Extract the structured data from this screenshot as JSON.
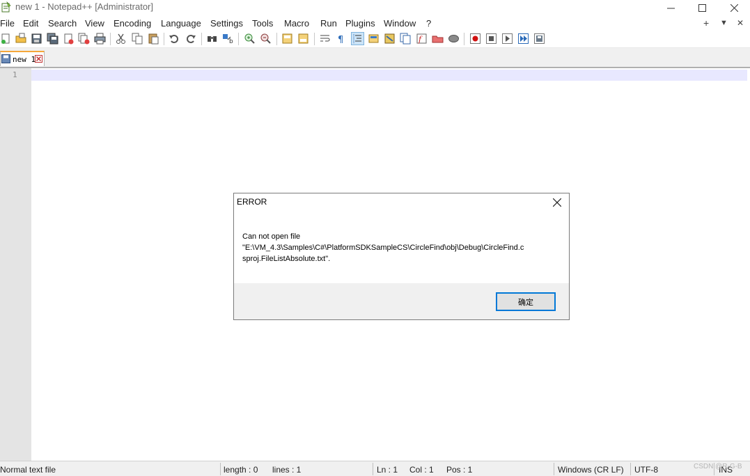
{
  "window": {
    "title": "new 1 - Notepad++ [Administrator]",
    "controls": {
      "minimize": "—",
      "maximize": "☐",
      "close": "✕"
    }
  },
  "menu": {
    "items": [
      "File",
      "Edit",
      "Search",
      "View",
      "Encoding",
      "Language",
      "Settings",
      "Tools",
      "Macro",
      "Run",
      "Plugins",
      "Window",
      "?"
    ],
    "right": {
      "add": "+",
      "dropdown": "▼",
      "close": "✕"
    }
  },
  "toolbar": {
    "icons": [
      "new-file-icon",
      "open-file-icon",
      "save-icon",
      "save-all-icon",
      "close-icon",
      "close-all-icon",
      "print-icon",
      "cut-icon",
      "copy-icon",
      "paste-icon",
      "undo-icon",
      "redo-icon",
      "find-icon",
      "replace-icon",
      "zoom-in-icon",
      "zoom-out-icon",
      "sync-vertical-icon",
      "sync-horizontal-icon",
      "word-wrap-icon",
      "show-all-chars-icon",
      "indent-guide-icon",
      "user-language-icon",
      "doc-map-icon",
      "doc-list-icon",
      "function-list-icon",
      "folder-workspace-icon",
      "monitoring-icon",
      "record-macro-icon",
      "stop-record-icon",
      "play-macro-icon",
      "run-multiple-macro-icon",
      "save-macro-icon"
    ],
    "active_icon": "indent-guide-icon"
  },
  "tabs": [
    {
      "label": "new 1",
      "close_glyph": "✕"
    }
  ],
  "editor": {
    "line_numbers": [
      "1"
    ],
    "content": ""
  },
  "status": {
    "file_type": "Normal text file",
    "length": "length : 0",
    "lines": "lines : 1",
    "ln": "Ln : 1",
    "col": "Col : 1",
    "pos": "Pos : 1",
    "eol": "Windows (CR LF)",
    "encoding": "UTF-8",
    "mode": "INS"
  },
  "watermark": "CSDN @R-G-B",
  "dialog": {
    "title": "ERROR",
    "message_lines": [
      "Can not open file",
      "\"E:\\VM_4.3\\Samples\\C#\\PlatformSDKSampleCS\\CircleFind\\obj\\Debug\\CircleFind.c",
      "sproj.FileListAbsolute.txt\"."
    ],
    "ok_label": "确定",
    "close_glyph": "✕"
  },
  "colors": {
    "accent": "#0078d7",
    "tab_top": "#f5a73a",
    "current_line": "#e8e8ff",
    "gutter": "#e4e4e4"
  }
}
